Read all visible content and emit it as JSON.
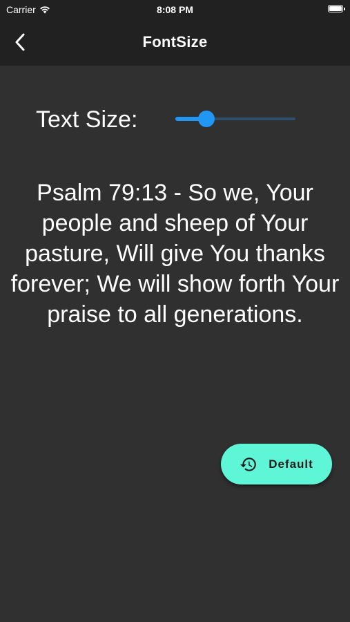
{
  "status_bar": {
    "carrier": "Carrier",
    "time": "8:08 PM"
  },
  "header": {
    "title": "FontSize",
    "back_icon": "chevron-left-icon"
  },
  "settings": {
    "text_size_label": "Text Size:",
    "slider_fraction": 0.26,
    "accent_color": "#2196f3"
  },
  "preview": {
    "verse": "Psalm 79:13 - So we, Your people and sheep of Your pasture, Will give You thanks forever; We will show forth Your praise to all generations."
  },
  "fab": {
    "label": "Default",
    "icon": "history-icon",
    "color": "#5ff5d7"
  }
}
